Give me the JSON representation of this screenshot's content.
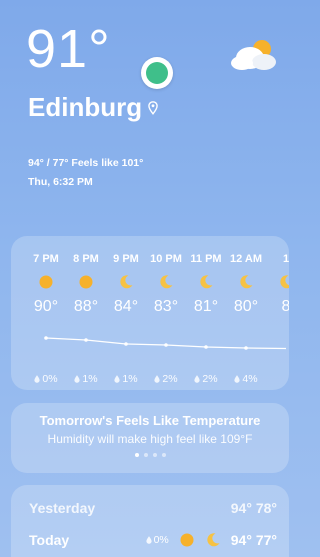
{
  "current": {
    "temp": "91°",
    "city": "Edinburg",
    "feels_like": "94° / 77° Feels like 101°",
    "datetime": "Thu, 6:32 PM",
    "condition_icon": "sun-behind-cloud-icon"
  },
  "hourly": [
    {
      "time": "7 PM",
      "icon": "sun-icon",
      "temp": "90°",
      "precip": "0%"
    },
    {
      "time": "8 PM",
      "icon": "sun-icon",
      "temp": "88°",
      "precip": "1%"
    },
    {
      "time": "9 PM",
      "icon": "moon-icon",
      "temp": "84°",
      "precip": "1%"
    },
    {
      "time": "10 PM",
      "icon": "moon-icon",
      "temp": "83°",
      "precip": "2%"
    },
    {
      "time": "11 PM",
      "icon": "moon-icon",
      "temp": "81°",
      "precip": "2%"
    },
    {
      "time": "12 AM",
      "icon": "moon-icon",
      "temp": "80°",
      "precip": "4%"
    },
    {
      "time": "1",
      "icon": "moon-icon",
      "temp": "8",
      "precip": ""
    }
  ],
  "tomorrow": {
    "title": "Tomorrow's Feels Like Temperature",
    "subtitle": "Humidity will make high feel like 109°F"
  },
  "daily": {
    "yesterday": {
      "label": "Yesterday",
      "temps": "94° 78°"
    },
    "today": {
      "label": "Today",
      "precip": "0%",
      "temps": "94° 77°"
    }
  },
  "colors": {
    "sun": "#f6b12b",
    "moon": "#f6c244",
    "accent_dot": "#3fbf8a"
  }
}
